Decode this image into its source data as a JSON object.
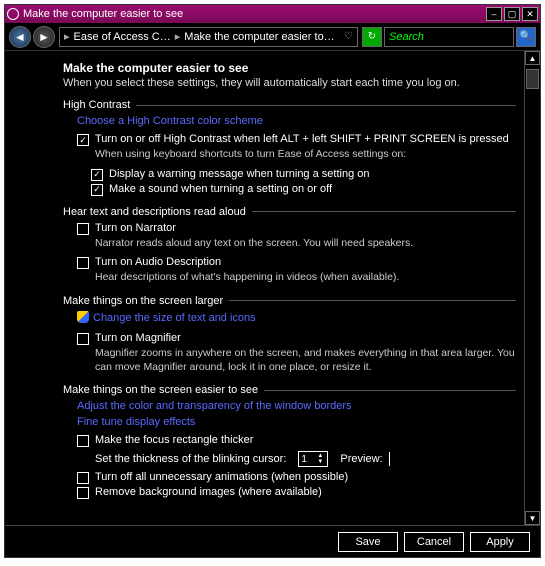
{
  "window": {
    "title": "Make the computer easier to see"
  },
  "nav": {
    "crumb1": "Ease of Access C…",
    "crumb2": "Make the computer easier to…",
    "search_placeholder": "Search"
  },
  "page": {
    "heading": "Make the computer easier to see",
    "sub": "When you select these settings, they will automatically start each time you log on."
  },
  "hc": {
    "title": "High Contrast",
    "link": "Choose a High Contrast color scheme",
    "cb1": "Turn on or off High Contrast when left ALT + left SHIFT + PRINT SCREEN is pressed",
    "lead": "When using keyboard shortcuts to turn Ease of Access settings on:",
    "cb2": "Display a warning message when turning a setting on",
    "cb3": "Make a sound when turning a setting on or off"
  },
  "hear": {
    "title": "Hear text and descriptions read aloud",
    "cb1": "Turn on Narrator",
    "d1": "Narrator reads aloud any text on the screen. You will need speakers.",
    "cb2": "Turn on Audio Description",
    "d2": "Hear descriptions of what's happening in videos (when available)."
  },
  "larger": {
    "title": "Make things on the screen larger",
    "link": "Change the size of text and icons",
    "cb1": "Turn on Magnifier",
    "d1": "Magnifier zooms in anywhere on the screen, and makes everything in that area larger. You can move Magnifier around, lock it in one place, or resize it."
  },
  "easier": {
    "title": "Make things on the screen easier to see",
    "link1": "Adjust the color and transparency of the window borders",
    "link2": "Fine tune display effects",
    "cb1": "Make the focus rectangle thicker",
    "cursor_label": "Set the thickness of the blinking cursor:",
    "cursor_value": "1",
    "preview_label": "Preview:",
    "cb2": "Turn off all unnecessary animations (when possible)",
    "cb3": "Remove background images (where available)"
  },
  "footer": {
    "save": "Save",
    "cancel": "Cancel",
    "apply": "Apply"
  }
}
